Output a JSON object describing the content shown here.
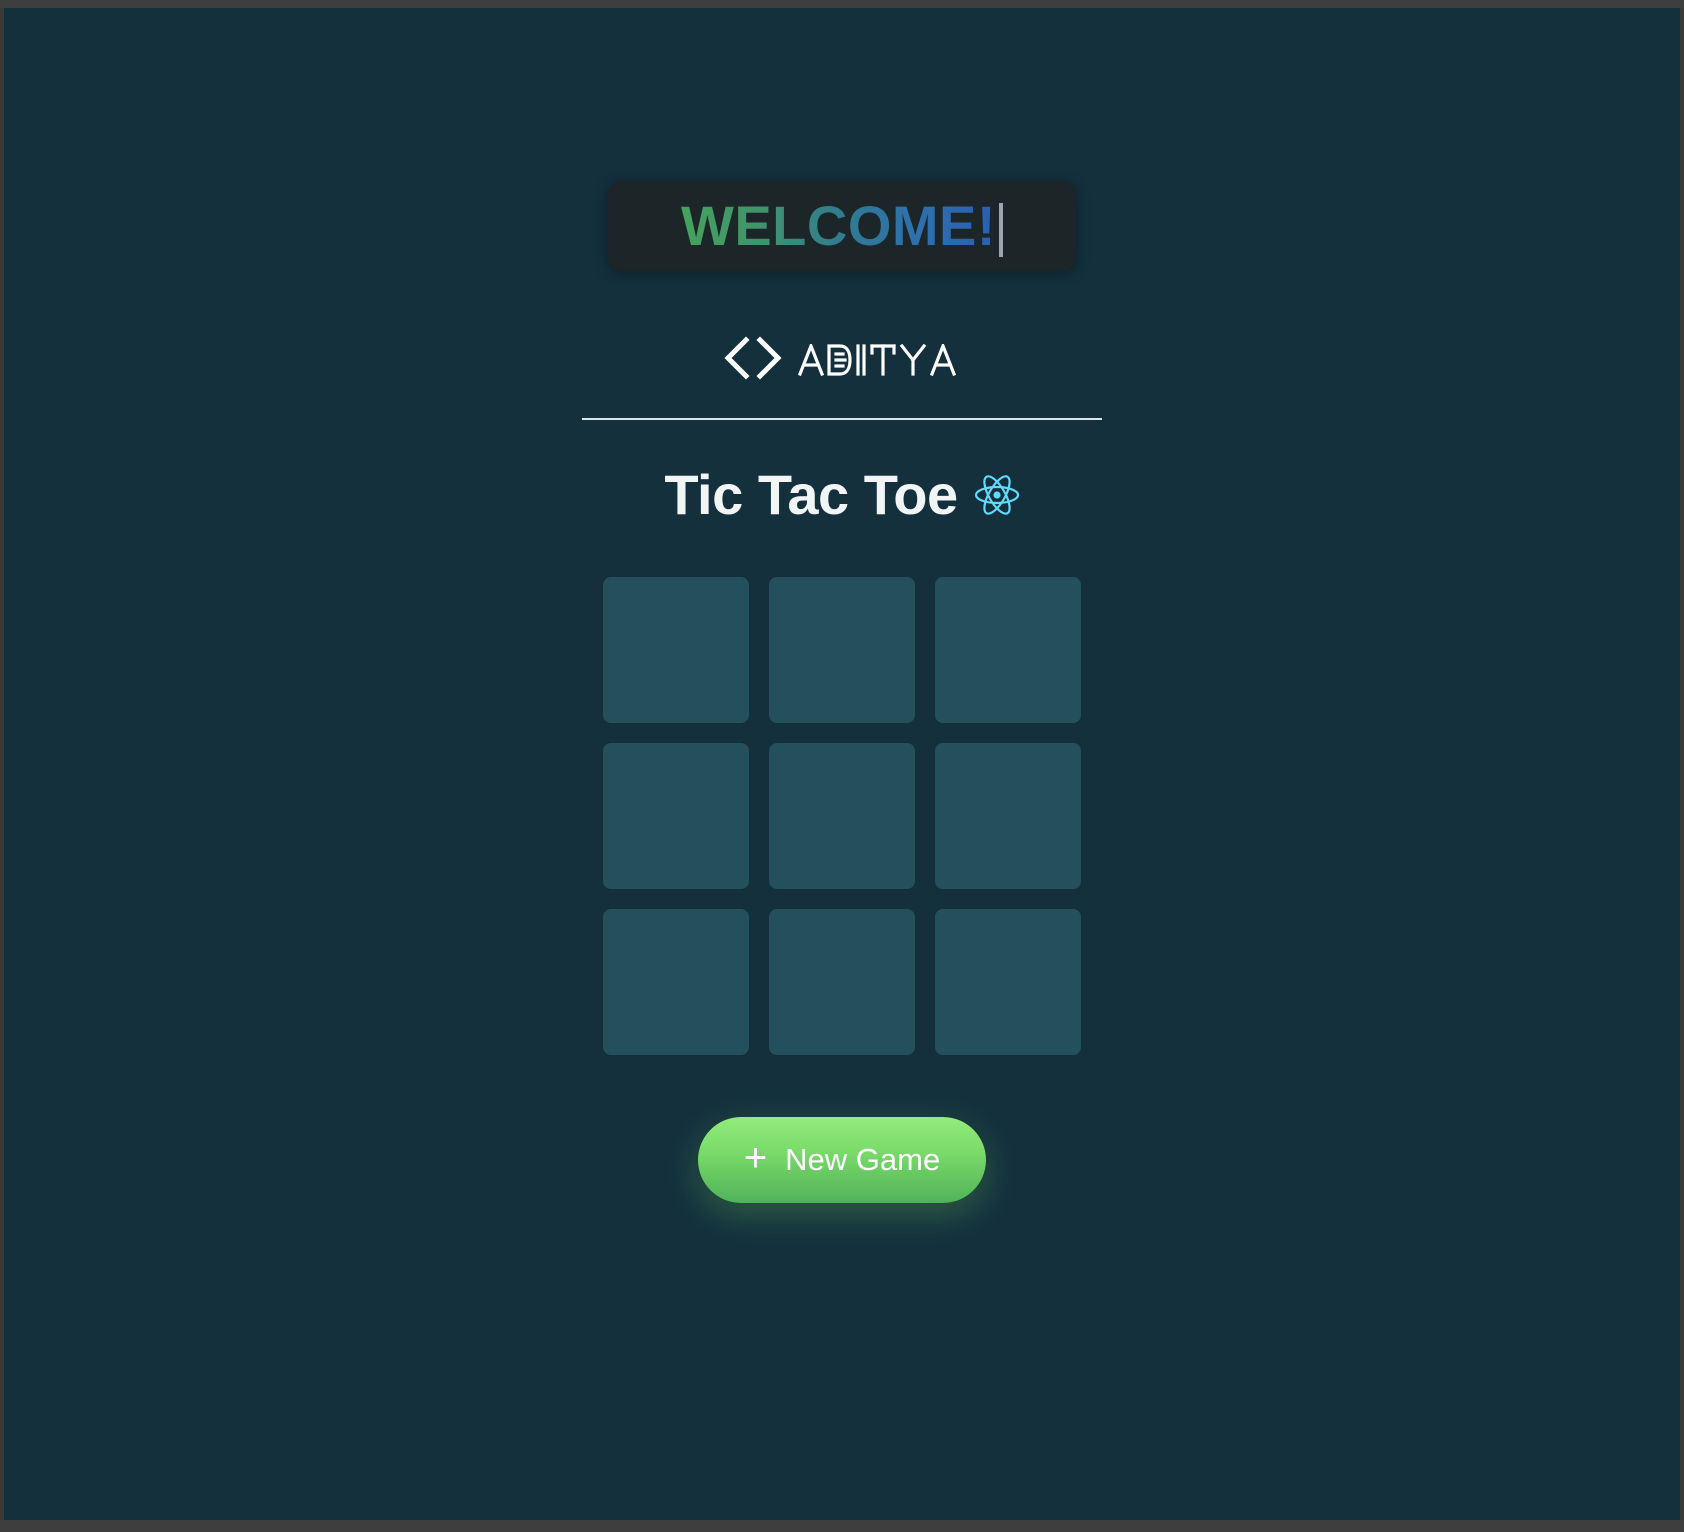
{
  "page": {
    "background_color": "#14303d",
    "frame_color": "#3e3e3e"
  },
  "welcome": {
    "text": "WELCOME!",
    "box_color": "#1c2528",
    "gradient_start": "#45a35c",
    "gradient_end": "#2a5fb0",
    "caret_visible": true
  },
  "brand": {
    "icon": "code-chevrons-icon",
    "name": "ADITYA"
  },
  "divider": {
    "color": "#dfe4e6"
  },
  "game": {
    "title": "Tic Tac Toe",
    "framework_icon": "react-logo-icon",
    "framework_icon_color": "#61dafb",
    "board": {
      "rows": 3,
      "cols": 3,
      "cell_color": "#24505c",
      "cells": [
        "",
        "",
        "",
        "",
        "",
        "",
        "",
        "",
        ""
      ]
    },
    "new_game_button": {
      "label": "New Game",
      "icon": "plus-icon",
      "icon_glyph": "+",
      "gradient_start": "#93eb7c",
      "gradient_end": "#50b359"
    }
  }
}
